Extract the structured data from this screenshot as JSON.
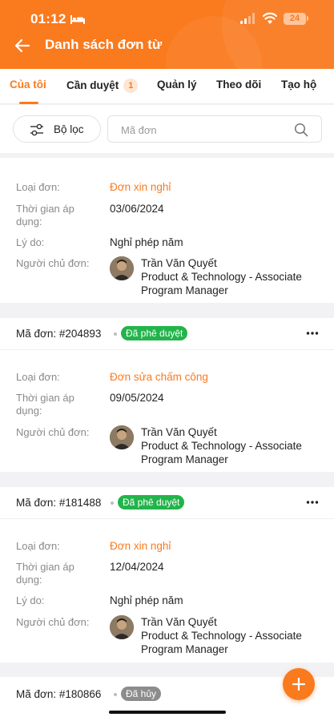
{
  "status_bar": {
    "time": "01:12",
    "battery": "24"
  },
  "header": {
    "title": "Danh sách đơn từ"
  },
  "tabs": [
    {
      "label": "Của tôi",
      "active": true
    },
    {
      "label": "Cần duyệt",
      "badge": "1"
    },
    {
      "label": "Quản lý"
    },
    {
      "label": "Theo dõi"
    },
    {
      "label": "Tạo hộ"
    }
  ],
  "filter": {
    "button_label": "Bộ lọc",
    "search_placeholder": "Mã đơn"
  },
  "labels": {
    "type": "Loại đơn:",
    "time_line1": "Thời gian áp",
    "time_line2": "dụng:",
    "reason": "Lý do:",
    "owner": "Người chủ đơn:"
  },
  "cards": [
    {
      "type": "Đơn xin nghỉ",
      "date": "03/06/2024",
      "reason": "Nghỉ phép năm",
      "owner_name": "Trần Văn Quyết",
      "owner_role_line1": "Product & Technology - Associate",
      "owner_role_line2": "Program Manager"
    },
    {
      "id": "Mã đơn: #204893",
      "status": "Đã phê duyệt",
      "type": "Đơn sửa chấm công",
      "date": "09/05/2024",
      "owner_name": "Trần Văn Quyết",
      "owner_role_line1": "Product & Technology - Associate",
      "owner_role_line2": "Program Manager"
    },
    {
      "id": "Mã đơn: #181488",
      "status": "Đã phê duyệt",
      "type": "Đơn xin nghỉ",
      "date": "12/04/2024",
      "reason": "Nghỉ phép năm",
      "owner_name": "Trần Văn Quyết",
      "owner_role_line1": "Product & Technology - Associate",
      "owner_role_line2": "Program Manager"
    },
    {
      "id": "Mã đơn: #180866",
      "status": "Đã hủy"
    }
  ],
  "colors": {
    "accent": "#fa7a1e",
    "approved": "#22b44a",
    "cancelled": "#8c8c8c"
  }
}
